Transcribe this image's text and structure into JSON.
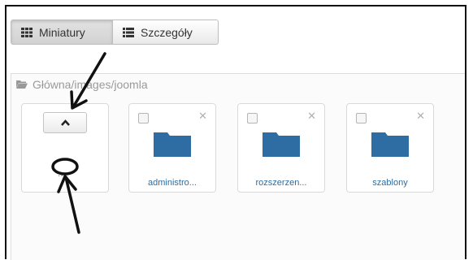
{
  "toolbar": {
    "thumbnails_label": "Miniatury",
    "details_label": "Szczegóły"
  },
  "breadcrumb": {
    "path": "Główna/images/joomla"
  },
  "up_card": {
    "parent_label": ".."
  },
  "folders": [
    {
      "label": "administro..."
    },
    {
      "label": "rozszerzen..."
    },
    {
      "label": "szablony"
    }
  ],
  "colors": {
    "folder": "#2e6da4",
    "link": "#2d6ca2",
    "annotation": "#111111"
  }
}
